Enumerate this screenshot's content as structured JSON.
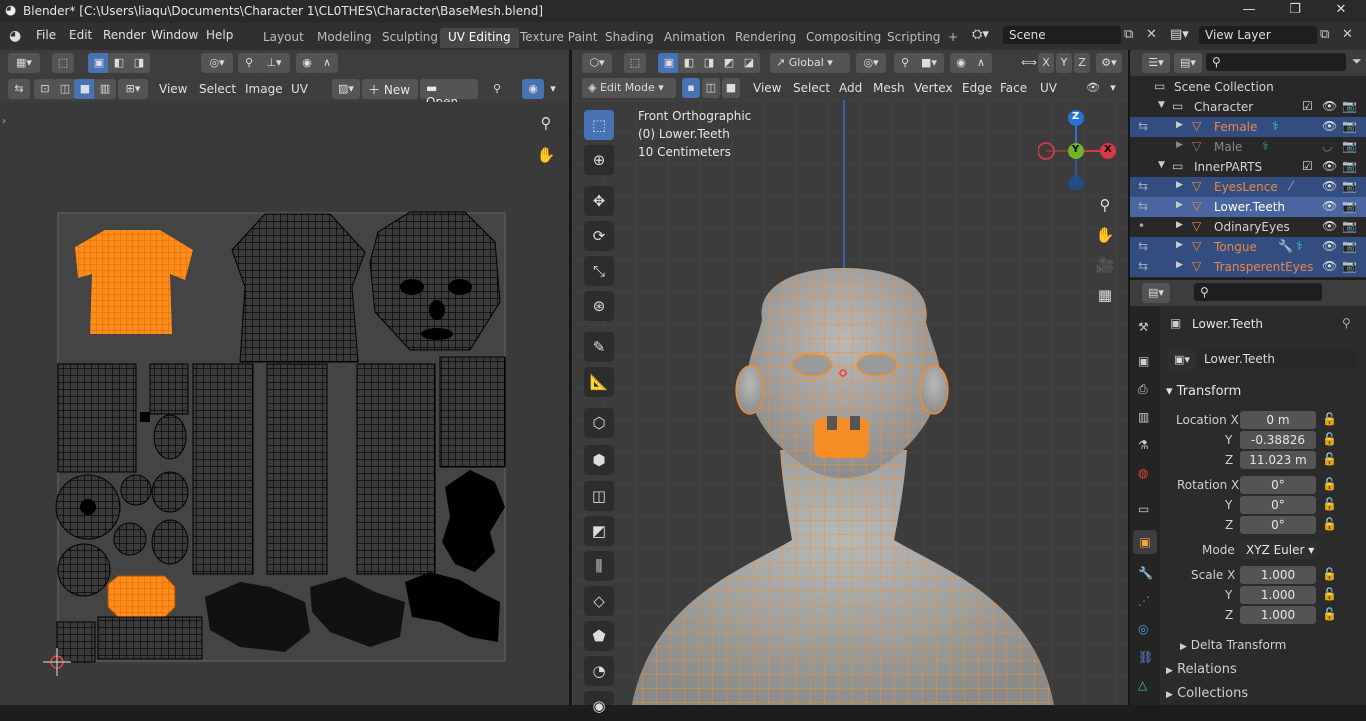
{
  "titlebar": {
    "title": "Blender* [C:\\Users\\liaqu\\Documents\\Character 1\\CL0THES\\Character\\BaseMesh.blend]",
    "minimize": "—",
    "maximize": "❐",
    "close": "✕"
  },
  "menu": {
    "items": [
      "File",
      "Edit",
      "Render",
      "Window",
      "Help"
    ]
  },
  "workspaces": [
    "Layout",
    "Modeling",
    "Sculpting",
    "UV Editing",
    "Texture Paint",
    "Shading",
    "Animation",
    "Rendering",
    "Compositing",
    "Scripting",
    "+"
  ],
  "active_workspace": "UV Editing",
  "scene": {
    "name": "Scene"
  },
  "view_layer": {
    "name": "View Layer"
  },
  "uv_editor": {
    "menus": [
      "View",
      "Select",
      "Image",
      "UV"
    ],
    "new_label": "New",
    "open_label": "Open"
  },
  "viewport": {
    "mode": "Edit Mode",
    "menus": [
      "View",
      "Select",
      "Add",
      "Mesh",
      "Vertex",
      "Edge",
      "Face",
      "UV"
    ],
    "transform_orientation": "Global",
    "info_view": "Front Orthographic",
    "info_object": "(0) Lower.Teeth",
    "info_scale": "10 Centimeters",
    "axes": {
      "x": "X",
      "y": "Y",
      "z": "Z"
    },
    "xyz_toggle": [
      "X",
      "Y",
      "Z"
    ]
  },
  "outliner": {
    "header": "Scene Collection",
    "rows": [
      {
        "name": "Character",
        "type": "collection",
        "selected": false
      },
      {
        "name": "Female",
        "type": "object",
        "selected": true,
        "orange": true
      },
      {
        "name": "Male",
        "type": "object",
        "selected": false,
        "dim": true
      },
      {
        "name": "InnerPARTS",
        "type": "collection",
        "selected": false
      },
      {
        "name": "EyesLence",
        "type": "object",
        "selected": true,
        "orange": true
      },
      {
        "name": "Lower.Teeth",
        "type": "object",
        "selected": true,
        "active": true
      },
      {
        "name": "OdinaryEyes",
        "type": "object",
        "selected": false
      },
      {
        "name": "Tongue",
        "type": "object",
        "selected": true,
        "orange": true
      },
      {
        "name": "TransperentEyes",
        "type": "object",
        "selected": true,
        "orange": true
      }
    ]
  },
  "properties": {
    "object_name": "Lower.Teeth",
    "datablock": "Lower.Teeth",
    "transform_label": "Transform",
    "location_label": "Location X",
    "rotation_label": "Rotation X",
    "scale_label": "Scale X",
    "y_label": "Y",
    "z_label": "Z",
    "location": [
      "0 m",
      "-0.38826",
      "11.023 m"
    ],
    "rotation": [
      "0°",
      "0°",
      "0°"
    ],
    "mode_label": "Mode",
    "mode_value": "XYZ Euler",
    "scale": [
      "1.000",
      "1.000",
      "1.000"
    ],
    "delta_transform": "Delta Transform",
    "relations": "Relations",
    "collections": "Collections"
  },
  "colors": {
    "accent_blue": "#4772b3",
    "selection_orange": "#ff8c1a",
    "outliner_selected": "#334d80"
  }
}
